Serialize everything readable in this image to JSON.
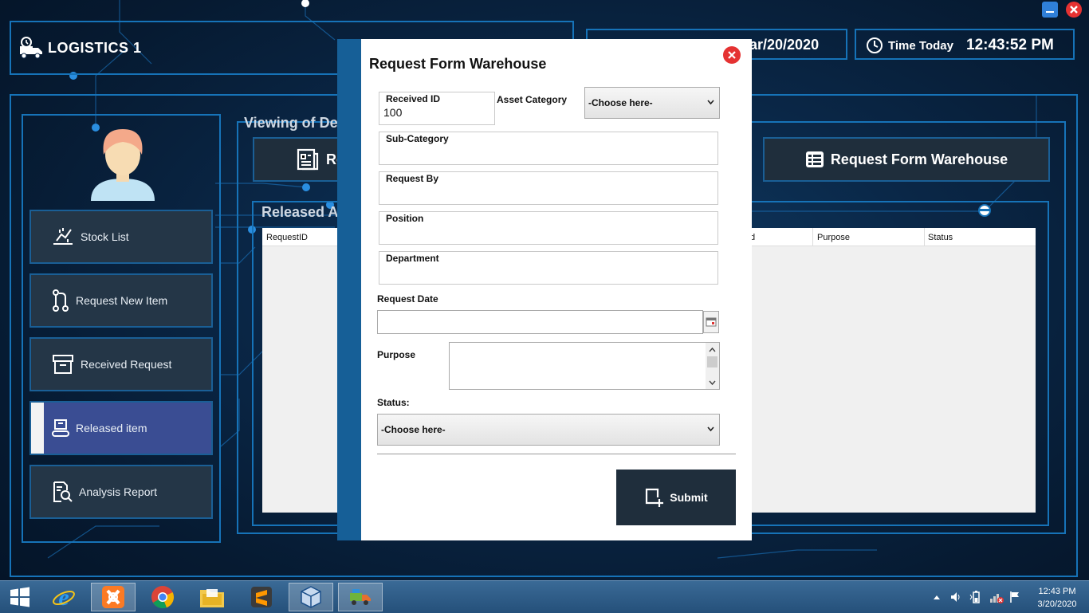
{
  "window": {
    "minimize_icon": "minimize-icon",
    "close_icon": "close-icon"
  },
  "header": {
    "app_title": "LOGISTICS 1",
    "date_partial": "ar/20/2020",
    "time_label": "Time Today",
    "time_value": "12:43:52 PM"
  },
  "sidebar": {
    "items": [
      {
        "label": "Stock List",
        "icon": "stock-chart-icon"
      },
      {
        "label": "Request New Item",
        "icon": "pull-request-icon"
      },
      {
        "label": "Received Request",
        "icon": "archive-box-icon"
      },
      {
        "label": "Released item",
        "icon": "conveyor-icon",
        "active": true
      },
      {
        "label": "Analysis Report",
        "icon": "report-search-icon"
      }
    ]
  },
  "content": {
    "viewing_title_partial": "Viewing of De",
    "left_button_partial": "Re",
    "right_button_label": "Request Form Warehouse",
    "released_title_partial": "Released A",
    "grid_columns": [
      "RequestID",
      "d",
      "Purpose",
      "Status"
    ]
  },
  "modal": {
    "title": "Request Form Warehouse",
    "received_id_label": "Received ID",
    "received_id_value": "100",
    "asset_category_label": "Asset Category",
    "asset_category_selected": "-Choose here-",
    "sub_category_label": "Sub-Category",
    "request_by_label": "Request By",
    "position_label": "Position",
    "department_label": "Department",
    "request_date_label": "Request Date",
    "purpose_label": "Purpose",
    "status_label": "Status:",
    "status_selected": "-Choose here-",
    "submit_label": "Submit"
  },
  "taskbar": {
    "apps": [
      "windows-start",
      "internet-explorer",
      "xampp",
      "chrome",
      "file-explorer",
      "sublime-text",
      "virtualbox",
      "logistics-app"
    ],
    "clock_time": "12:43 PM",
    "clock_date": "3/20/2020"
  }
}
